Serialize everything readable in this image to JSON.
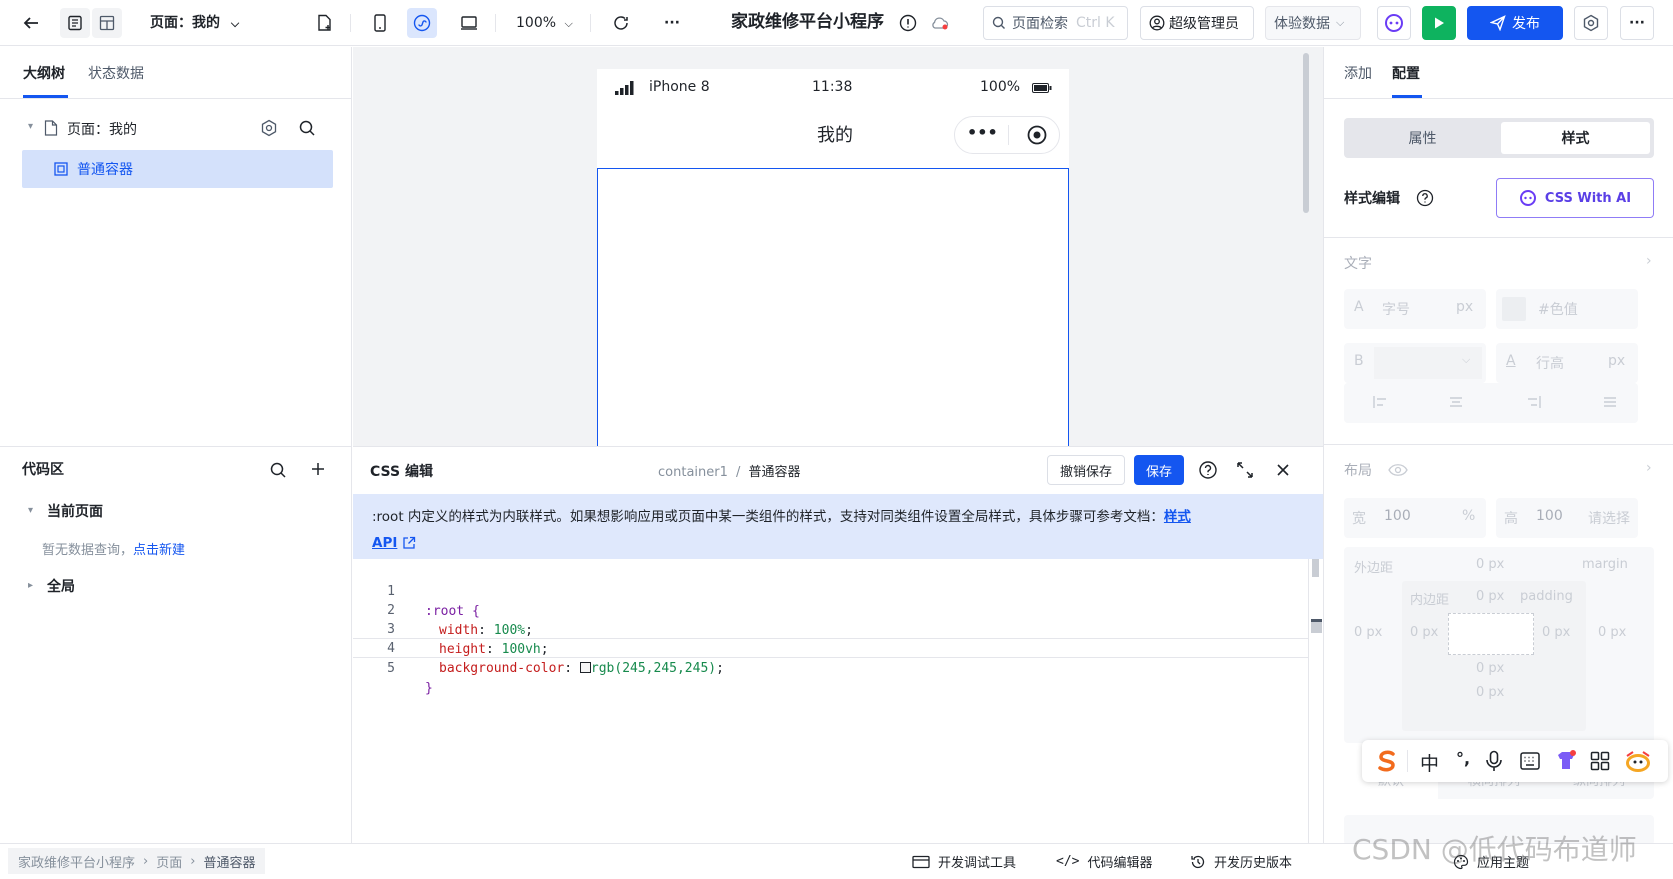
{
  "topbar": {
    "page_selector": "页面：我的",
    "zoom": "100%",
    "app_title": "家政维修平台小程序",
    "search_placeholder": "页面检索",
    "search_shortcut": "Ctrl K",
    "user_role": "超级管理员",
    "data_mode": "体验数据",
    "publish_label": "发布",
    "more_label": "···"
  },
  "left_panel": {
    "tabs": [
      "大纲树",
      "状态数据"
    ],
    "tree_page": "页面：我的",
    "tree_child": "普通容器",
    "code_area_title": "代码区",
    "current_page_label": "当前页面",
    "empty_hint": "暂无数据查询，",
    "empty_link": "点击新建",
    "global_label": "全局"
  },
  "phone": {
    "device": "iPhone 8",
    "time": "11:38",
    "battery": "100%",
    "page_title": "我的",
    "capsule_dots": "•••"
  },
  "css_editor": {
    "title": "CSS 编辑",
    "breadcrumb_1": "container1",
    "breadcrumb_sep": "/",
    "breadcrumb_2": "普通容器",
    "undo_label": "撤销保存",
    "save_label": "保存",
    "notice_text": ":root 内定义的样式为内联样式。如果想影响应用或页面中某一类组件的样式，支持对同类组件设置全局样式，具体步骤可参考文档：",
    "notice_link_1": "样式",
    "notice_link_2": "API",
    "code": [
      {
        "n": "1",
        "text": ":root {"
      },
      {
        "n": "2",
        "prop": "width",
        "val": "100%"
      },
      {
        "n": "3",
        "prop": "height",
        "val": "100vh"
      },
      {
        "n": "4",
        "prop": "background-color",
        "val": "rgb(245,245,245)"
      },
      {
        "n": "5",
        "text": "}"
      }
    ]
  },
  "right_panel": {
    "tabs": [
      "添加",
      "配置"
    ],
    "seg_attr": "属性",
    "seg_style": "样式",
    "style_edit_label": "样式编辑",
    "ai_button": "CSS With AI",
    "text_section": "文字",
    "font_size_icon": "A",
    "font_size_placeholder": "字号",
    "px": "px",
    "color_placeholder": "#色值",
    "bold_icon": "B",
    "line_height_placeholder": "行高",
    "layout_section": "布局",
    "width_label": "宽",
    "width_value": "100",
    "width_unit": "%",
    "height_label": "高",
    "height_value": "100",
    "height_placeholder": "请选择",
    "margin_label": "外边距",
    "margin_en": "margin",
    "padding_label": "内边距",
    "padding_en": "padding",
    "zero_px": "0 px",
    "default_label": "默认",
    "h_arrange": "横向排列",
    "v_arrange": "纵向排列"
  },
  "statusbar": {
    "crumbs": [
      "家政维修平台小程序",
      "页面",
      "普通容器"
    ],
    "dev_tools": "开发调试工具",
    "code_editor": "代码编辑器",
    "history": "开发历史版本",
    "theme": "应用主题"
  },
  "ime": {
    "lang": "中",
    "punct": "°,"
  },
  "watermark": "CSDN @低代码布道师",
  "colors": {
    "primary": "#1456f0",
    "publish_bg": "#1456f0",
    "preview_green": "#0eb35f",
    "selection_bg": "#d4e1fb",
    "notice_bg": "#dfe8fc",
    "code_prop": "#c41d1d",
    "code_val": "#178a4d",
    "code_selector": "#7a1fa2"
  }
}
